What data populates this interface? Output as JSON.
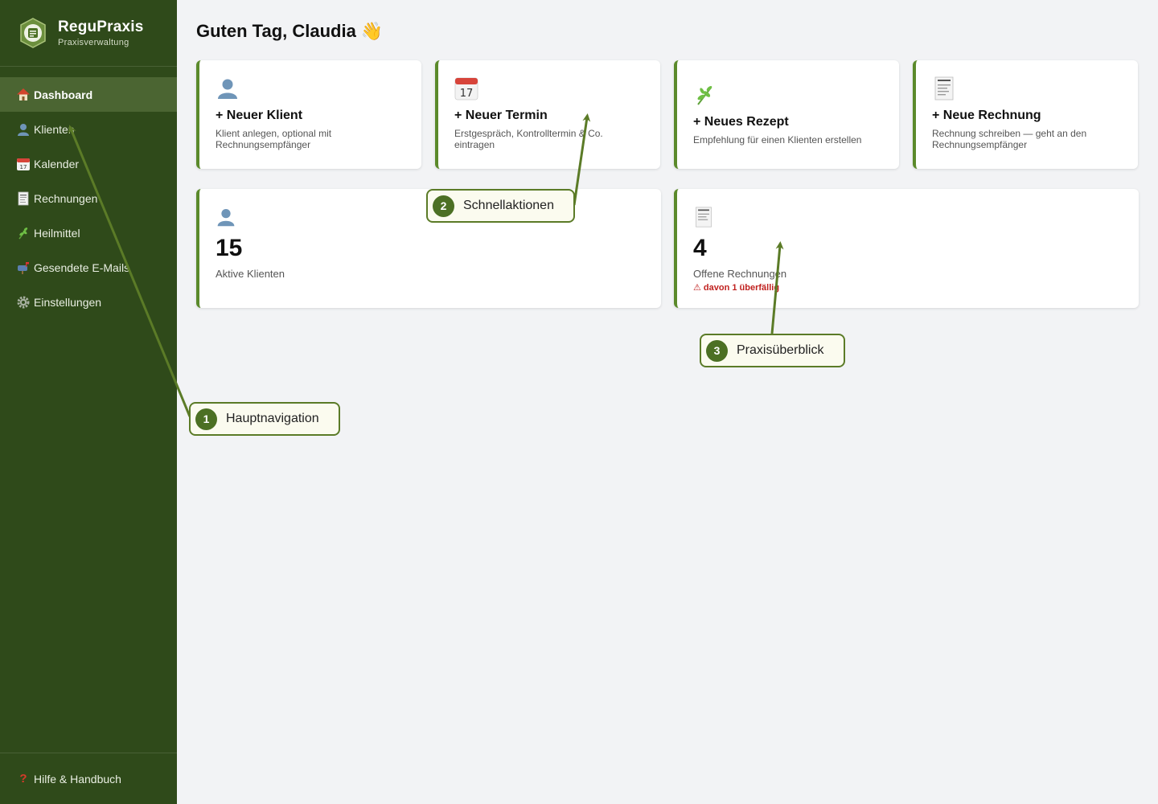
{
  "brand": {
    "name": "ReguPraxis",
    "subtitle": "Praxisverwaltung"
  },
  "nav": {
    "items": [
      {
        "label": "Dashboard",
        "icon": "house-icon",
        "active": true
      },
      {
        "label": "Klienten",
        "icon": "person-icon"
      },
      {
        "label": "Kalender",
        "icon": "calendar-icon"
      },
      {
        "label": "Rechnungen",
        "icon": "receipt-icon"
      },
      {
        "label": "Heilmittel",
        "icon": "herb-icon"
      },
      {
        "label": "Gesendete E-Mails",
        "icon": "mailbox-icon"
      },
      {
        "label": "Einstellungen",
        "icon": "gear-icon"
      }
    ],
    "help": {
      "label": "Hilfe & Handbuch",
      "icon": "question-icon",
      "glyph": "?"
    }
  },
  "greeting": {
    "text": "Guten Tag, Claudia",
    "emoji": "👋"
  },
  "quick_actions": [
    {
      "title": "+ Neuer Klient",
      "desc": "Klient anlegen, optional mit Rechnungsempfänger",
      "icon": "person-icon"
    },
    {
      "title": "+ Neuer Termin",
      "desc": "Erstgespräch, Kontrolltermin & Co. eintragen",
      "icon": "calendar-icon",
      "icon_text": "17"
    },
    {
      "title": "+ Neues Rezept",
      "desc": "Empfehlung für einen Klienten erstellen",
      "icon": "herb-icon"
    },
    {
      "title": "+ Neue Rechnung",
      "desc": "Rechnung schreiben — geht an den Rechnungsempfänger",
      "icon": "receipt-icon"
    }
  ],
  "stats": {
    "clients": {
      "value": "15",
      "label": "Aktive Klienten"
    },
    "invoices": {
      "value": "4",
      "label": "Offene Rechnungen",
      "warning": "⚠ davon 1 überfällig"
    }
  },
  "callouts": [
    {
      "num": "1",
      "label": "Hauptnavigation"
    },
    {
      "num": "2",
      "label": "Schnellaktionen"
    },
    {
      "num": "3",
      "label": "Praxisüberblick"
    }
  ],
  "colors": {
    "sidebar": "#2f4a1a",
    "accent": "#5b8a2b",
    "callout_border": "#5b7b27",
    "warning": "#c0211f"
  }
}
